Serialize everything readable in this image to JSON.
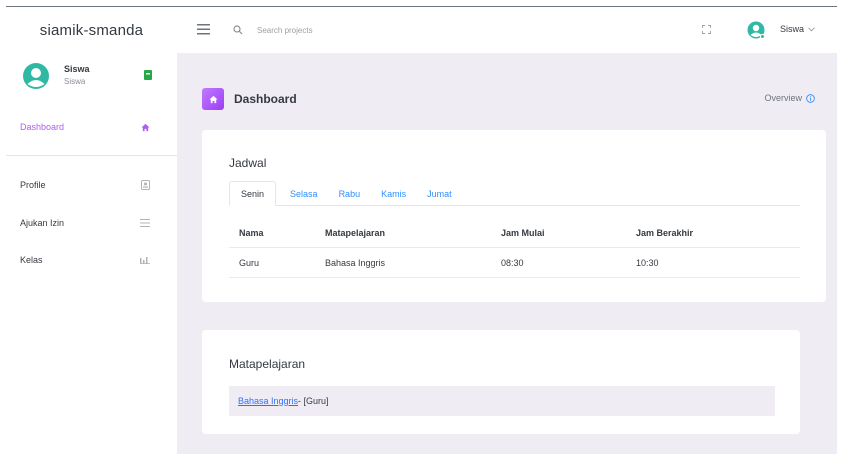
{
  "brand": "siamik-smanda",
  "user": {
    "name": "Siswa",
    "role": "Siswa"
  },
  "sidebar": {
    "items": [
      {
        "label": "Dashboard",
        "icon": "home-icon",
        "active": true
      },
      {
        "label": "Profile",
        "icon": "id-card-icon"
      },
      {
        "label": "Ajukan Izin",
        "icon": "list-icon"
      },
      {
        "label": "Kelas",
        "icon": "bar-chart-icon"
      }
    ]
  },
  "header": {
    "search_placeholder": "Search projects",
    "user_label": "Siswa",
    "dropdown_icon": "chevron-down-icon"
  },
  "page": {
    "title": "Dashboard",
    "overview": "Overview"
  },
  "jadwal": {
    "title": "Jadwal",
    "tabs": [
      "Senin",
      "Selasa",
      "Rabu",
      "Kamis",
      "Jumat"
    ],
    "active_tab": "Senin",
    "columns": [
      "Nama",
      "Matapelajaran",
      "Jam Mulai",
      "Jam Berakhir"
    ],
    "rows": [
      [
        "Guru",
        "Bahasa Inggris",
        "08:30",
        "10:30"
      ]
    ]
  },
  "matapelajaran": {
    "title": "Matapelajaran",
    "items": [
      {
        "name": "Bahasa Inggris",
        "suffix": " - [Guru]"
      }
    ]
  },
  "colors": {
    "accent": "#b15cf5",
    "link": "#2f8fff",
    "main_bg": "#efedf3",
    "user_badge": "#28a745"
  }
}
